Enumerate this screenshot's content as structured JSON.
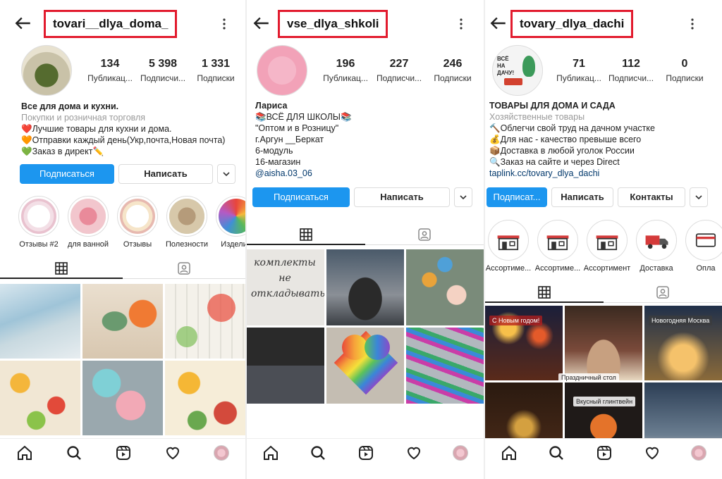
{
  "panels": [
    {
      "username": "tovari__dlya_doma_",
      "stats": [
        {
          "value": "134",
          "label": "Публикац..."
        },
        {
          "value": "5 398",
          "label": "Подписчи..."
        },
        {
          "value": "1 331",
          "label": "Подписки"
        }
      ],
      "bio": {
        "name": "Все для дома и кухни.",
        "category": "Покупки и розничная торговля",
        "lines": [
          "❤️Лучшие товары для кухни и дома.",
          "🧡Отправки каждый день(Укр,почта,Новая почта)",
          "💚Заказ в директ✏️"
        ]
      },
      "buttons": {
        "subscribe": "Подписаться",
        "message": "Написать"
      },
      "highlights": [
        "Отзывы #2",
        "для ванной",
        "Отзывы",
        "Полезности",
        "Изделия"
      ]
    },
    {
      "username": "vse_dlya_shkoli",
      "stats": [
        {
          "value": "196",
          "label": "Публикац..."
        },
        {
          "value": "227",
          "label": "Подписчи..."
        },
        {
          "value": "246",
          "label": "Подписки"
        }
      ],
      "bio": {
        "name": "Лариса",
        "lines": [
          "📚ВСЁ ДЛЯ ШКОЛЫ📚",
          "\"Оптом и в Розницу\"",
          "г.Аргун __Беркат",
          "6-модуль",
          "16-магазин"
        ],
        "link": "@aisha.03_06"
      },
      "buttons": {
        "subscribe": "Подписаться",
        "message": "Написать"
      },
      "tile_text": "комплекты не откладывать"
    },
    {
      "username": "tovary_dlya_dachi",
      "stats": [
        {
          "value": "71",
          "label": "Публикац..."
        },
        {
          "value": "112",
          "label": "Подписчи..."
        },
        {
          "value": "0",
          "label": "Подписки"
        }
      ],
      "bio": {
        "name": "ТОВАРЫ ДЛЯ ДОМА И САДА",
        "category": "Хозяйственные товары",
        "lines": [
          "🔨Облегчи свой труд на дачном участке",
          "💰Для нас - качество превыше всего",
          "📦Доставка в любой уголок России",
          "🔍Заказ на сайте и через Direct"
        ],
        "link": "taplink.cc/tovary_dlya_dachi"
      },
      "avatar_text": "ВСЁ НА ДАЧУ!",
      "buttons": {
        "subscribe": "Подписат...",
        "message": "Написать",
        "contacts": "Контакты"
      },
      "highlights": [
        "Ассортиме...",
        "Ассортиме...",
        "Ассортимент",
        "Доставка",
        "Опла"
      ],
      "tile_labels": [
        "С Новым годом!",
        "Новогодняя Москва",
        "Праздничный стол",
        "Вкусный глинтвейн"
      ]
    }
  ],
  "colors": {
    "accent": "#1c96ef",
    "highlight_box": "#e21b2e"
  }
}
